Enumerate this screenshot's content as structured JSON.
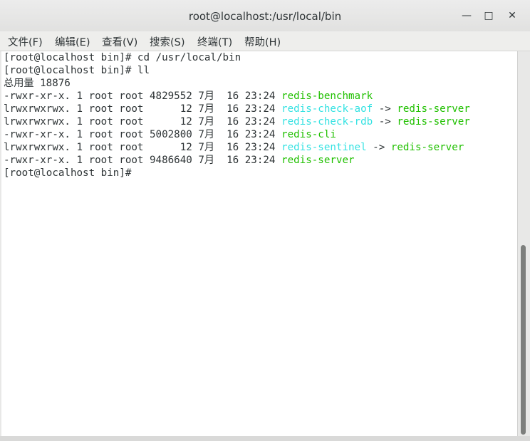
{
  "window": {
    "title": "root@localhost:/usr/local/bin",
    "minimize_glyph": "—",
    "maximize_glyph": "□",
    "close_glyph": "✕"
  },
  "menu": [
    "文件(F)",
    "编辑(E)",
    "查看(V)",
    "搜索(S)",
    "终端(T)",
    "帮助(H)"
  ],
  "terminal": {
    "prompt1": "[root@localhost bin]# cd /usr/local/bin",
    "prompt2": "[root@localhost bin]# ll",
    "total": "总用量 18876",
    "rows": [
      {
        "meta": "-rwxr-xr-x. 1 root root 4829552 7月  16 23:24 ",
        "name": "redis-benchmark",
        "arrow": "",
        "target": ""
      },
      {
        "meta": "lrwxrwxrwx. 1 root root      12 7月  16 23:24 ",
        "name": "redis-check-aof",
        "arrow": " -> ",
        "target": "redis-server"
      },
      {
        "meta": "lrwxrwxrwx. 1 root root      12 7月  16 23:24 ",
        "name": "redis-check-rdb",
        "arrow": " -> ",
        "target": "redis-server"
      },
      {
        "meta": "-rwxr-xr-x. 1 root root 5002800 7月  16 23:24 ",
        "name": "redis-cli",
        "arrow": "",
        "target": ""
      },
      {
        "meta": "lrwxrwxrwx. 1 root root      12 7月  16 23:24 ",
        "name": "redis-sentinel",
        "arrow": " -> ",
        "target": "redis-server"
      },
      {
        "meta": "-rwxr-xr-x. 1 root root 9486640 7月  16 23:24 ",
        "name": "redis-server",
        "arrow": "",
        "target": ""
      }
    ],
    "prompt3": "[root@localhost bin]# "
  },
  "colors": {
    "symlink": "#34e2e2",
    "executable": "#20c000",
    "text": "#2e3436"
  }
}
